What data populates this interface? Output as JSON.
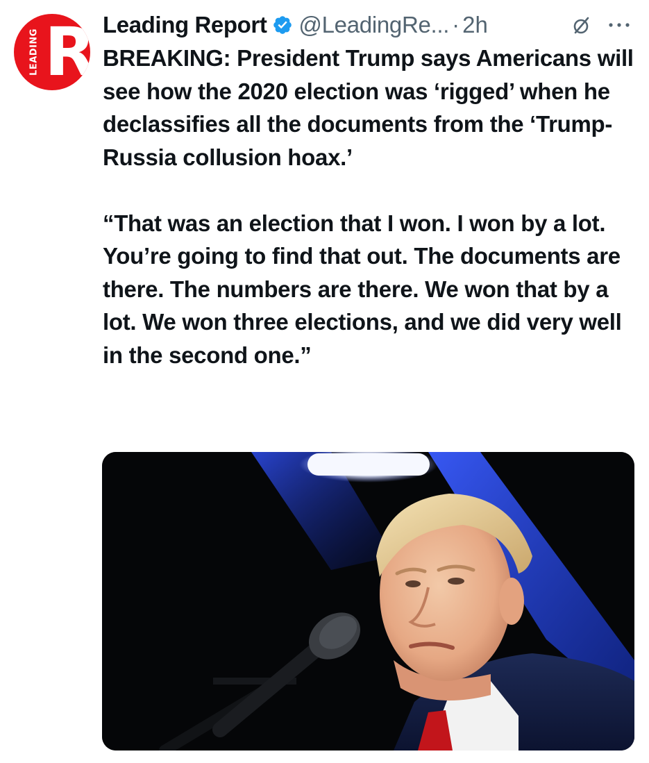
{
  "tweet": {
    "author_name": "Leading Report",
    "handle": "@LeadingRe...",
    "separator": "·",
    "time": "2h",
    "paragraphs": [
      "BREAKING: President Trump says Americans will see how the 2020 election was ‘rigged’ when he declassifies all the documents from the ‘Trump-Russia collusion hoax.’",
      "“That was an election that I won. I won by a lot. You’re going to find that out. The documents are there. The numbers are there. We won that by a lot. We won three elections, and we did very well in the second one.”"
    ]
  },
  "avatar": {
    "logo_letter": "R",
    "logo_text": "LEADING",
    "brand_color": "#e8141c"
  },
  "icons": {
    "verified": "verified-badge-icon",
    "grok": "grok-icon",
    "more": "more-options-icon"
  },
  "colors": {
    "text": "#0f1419",
    "secondary": "#536471",
    "verified_blue": "#1d9bf0"
  }
}
